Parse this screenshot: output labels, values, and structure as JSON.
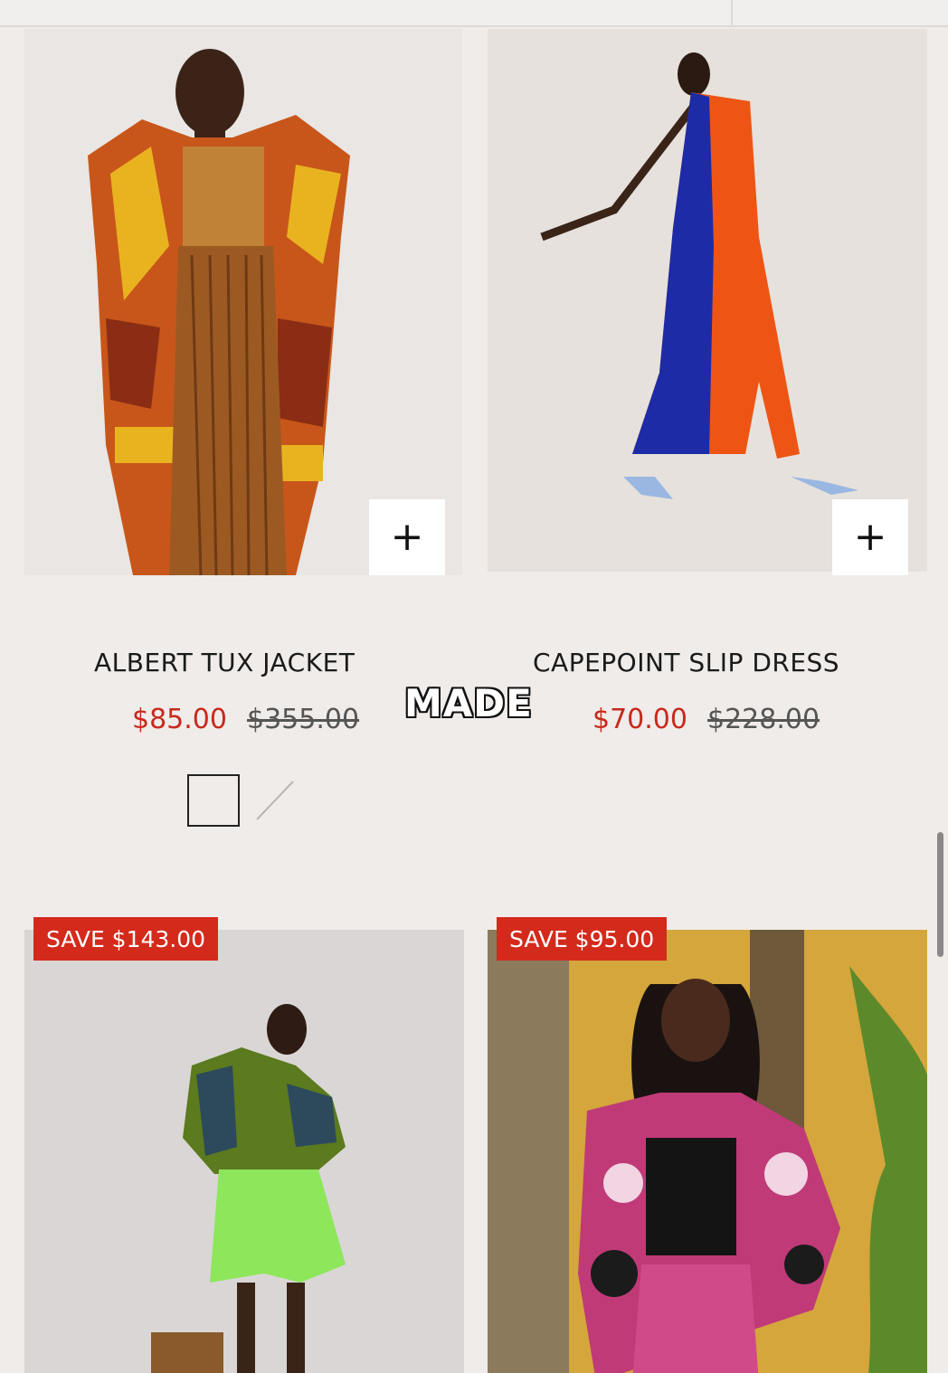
{
  "products": [
    {
      "title": "ALBERT TUX JACKET",
      "sale_price": "$85.00",
      "original_price": "$355.00",
      "add_icon": "plus-icon",
      "colors": {
        "swatch_border": "#222222"
      }
    },
    {
      "title": "CAPEPOINT SLIP DRESS",
      "sale_price": "$70.00",
      "original_price": "$228.00",
      "add_icon": "plus-icon"
    },
    {
      "badge": "SAVE $143.00"
    },
    {
      "badge": "SAVE $95.00"
    }
  ],
  "overlay_caption": "MADE",
  "colors": {
    "sale_red": "#c8291c",
    "badge_red": "#d42a1c",
    "background": "#efecea"
  }
}
